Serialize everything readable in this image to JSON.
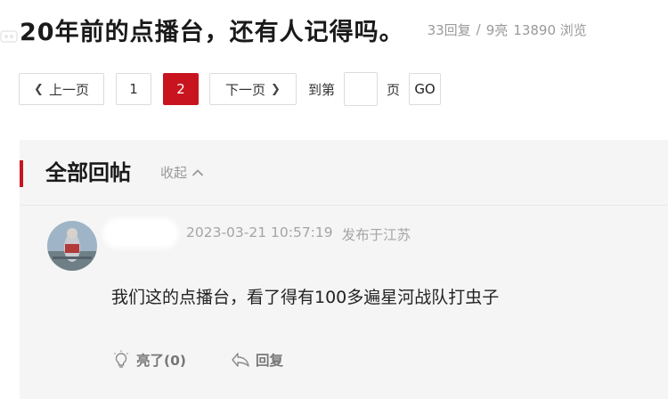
{
  "header": {
    "title": "20年前的点播台，还有人记得吗。",
    "replies": "33回复",
    "separator": "/",
    "lights": "9亮",
    "views": "13890 浏览"
  },
  "pagination": {
    "prev_label": "上一页",
    "pages": [
      "1",
      "2"
    ],
    "current_page": "2",
    "next_label": "下一页",
    "goto_prefix": "到第",
    "goto_value": "",
    "goto_suffix": "页",
    "go_label": "GO"
  },
  "section": {
    "title": "全部回帖",
    "collapse_label": "收起"
  },
  "post": {
    "timestamp": "2023-03-21 10:57:19",
    "location": "发布于江苏",
    "content": "我们这的点播台，看了得有100多遍星河战队打虫子",
    "like_label": "亮了(0)",
    "reply_label": "回复"
  },
  "colors": {
    "accent": "#c8141e",
    "section_bg": "#f5f5f5",
    "muted_text": "#9a9a9a"
  }
}
